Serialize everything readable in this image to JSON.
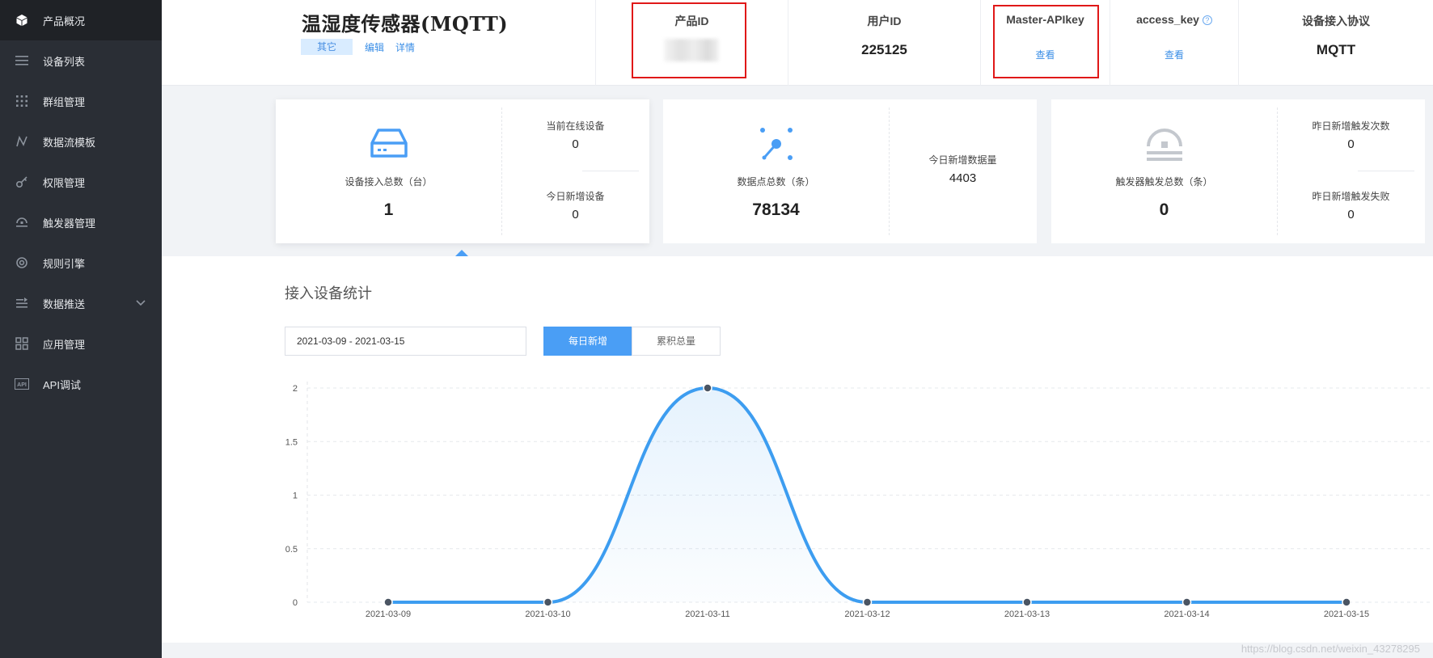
{
  "sidebar": {
    "items": [
      {
        "label": "产品概况",
        "icon": "cube-icon",
        "active": true
      },
      {
        "label": "设备列表",
        "icon": "list-icon"
      },
      {
        "label": "群组管理",
        "icon": "grid-dots-icon"
      },
      {
        "label": "数据流模板",
        "icon": "flow-icon"
      },
      {
        "label": "权限管理",
        "icon": "key-icon"
      },
      {
        "label": "触发器管理",
        "icon": "trigger-icon"
      },
      {
        "label": "规则引擎",
        "icon": "rule-icon"
      },
      {
        "label": "数据推送",
        "icon": "push-icon",
        "expandable": true
      },
      {
        "label": "应用管理",
        "icon": "apps-icon"
      },
      {
        "label": "API调试",
        "icon": "api-icon"
      }
    ]
  },
  "header": {
    "product_title": "温湿度传感器(MQTT)",
    "tag": "其它",
    "edit_link": "编辑",
    "detail_link": "详情",
    "product_id_label": "产品ID",
    "user_id_label": "用户ID",
    "user_id_value": "225125",
    "master_apikey_label": "Master-APIkey",
    "master_apikey_link": "查看",
    "access_key_label": "access_key",
    "access_key_link": "查看",
    "protocol_label": "设备接入协议",
    "protocol_value": "MQTT"
  },
  "cards": {
    "device": {
      "main_label": "设备接入总数（台）",
      "main_value": "1",
      "sub1_label": "当前在线设备",
      "sub1_value": "0",
      "sub2_label": "今日新增设备",
      "sub2_value": "0"
    },
    "data": {
      "main_label": "数据点总数（条）",
      "main_value": "78134",
      "sub1_label": "今日新增数据量",
      "sub1_value": "4403"
    },
    "trigger": {
      "main_label": "触发器触发总数（条）",
      "main_value": "0",
      "sub1_label": "昨日新增触发次数",
      "sub1_value": "0",
      "sub2_label": "昨日新增触发失败",
      "sub2_value": "0"
    }
  },
  "stats": {
    "title": "接入设备统计",
    "date_range": "2021-03-09 - 2021-03-15",
    "btn_daily": "每日新增",
    "btn_total": "累积总量"
  },
  "chart_data": {
    "type": "line",
    "categories": [
      "2021-03-09",
      "2021-03-10",
      "2021-03-11",
      "2021-03-12",
      "2021-03-13",
      "2021-03-14",
      "2021-03-15"
    ],
    "series": [
      {
        "values": [
          0,
          0,
          2,
          0,
          0,
          0,
          0
        ]
      }
    ],
    "yticks": [
      "0",
      "0.5",
      "1",
      "1.5",
      "2"
    ],
    "ylim": [
      0,
      2
    ],
    "smooth": true,
    "area_fill": true,
    "grid": true,
    "line_color": "#3d9df0"
  },
  "watermark": "https://blog.csdn.net/weixin_43278295",
  "colors": {
    "accent": "#4a9ef5",
    "highlight_box": "#e01818",
    "sidebar_bg": "#2a2e35"
  }
}
